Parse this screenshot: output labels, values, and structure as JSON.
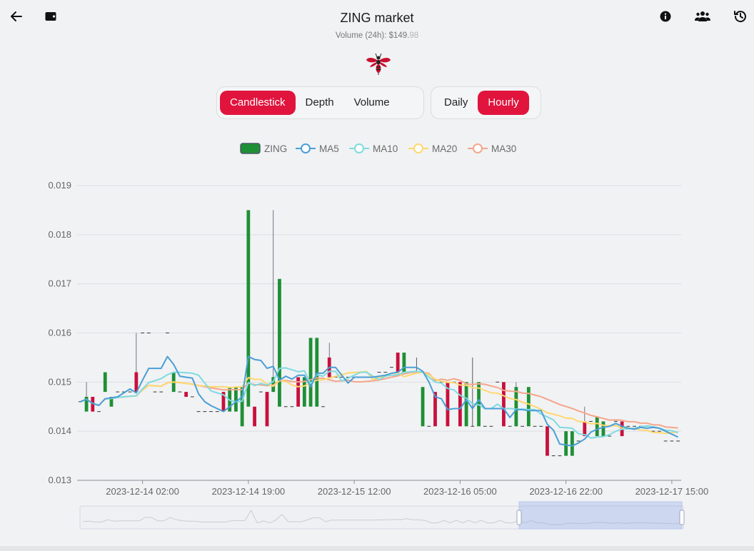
{
  "header": {
    "title": "ZING market",
    "volume_label": "Volume (24h): $149.",
    "volume_dim": "98",
    "back_icon": "arrow-left-icon",
    "wallet_icon": "wallet-icon",
    "info_icon": "info-icon",
    "users_icon": "users-icon",
    "history_icon": "history-icon",
    "logo_icon": "wasp-logo-icon"
  },
  "chart_tabs": [
    {
      "label": "Candlestick",
      "active": true
    },
    {
      "label": "Depth",
      "active": false
    },
    {
      "label": "Volume",
      "active": false
    }
  ],
  "interval_tabs": [
    {
      "label": "Daily",
      "active": false
    },
    {
      "label": "Hourly",
      "active": true
    }
  ],
  "colors": {
    "accent": "#e0143d",
    "up": "#1f8f35",
    "down": "#c8103d",
    "ma5": "#4a9fd6",
    "ma10": "#7fdbe0",
    "ma20": "#ffd86e",
    "ma30": "#f5a68a"
  },
  "chart_data": {
    "type": "candlestick",
    "title": "",
    "legend": [
      {
        "name": "ZING",
        "color": "#1f8f35"
      },
      {
        "name": "MA5",
        "color": "#4a9fd6"
      },
      {
        "name": "MA10",
        "color": "#7fdbe0"
      },
      {
        "name": "MA20",
        "color": "#ffd86e"
      },
      {
        "name": "MA30",
        "color": "#f5a68a"
      }
    ],
    "legend_position": "top-center",
    "grid": true,
    "ylim": [
      0.013,
      0.019
    ],
    "y_ticks": [
      "0.013",
      "0.014",
      "0.015",
      "0.016",
      "0.017",
      "0.018",
      "0.019"
    ],
    "x_ticks": [
      "2023-12-14 02:00",
      "2023-12-14 19:00",
      "2023-12-15 12:00",
      "2023-12-16 05:00",
      "2023-12-16 22:00",
      "2023-12-17 15:00"
    ],
    "x_tick_index": [
      10,
      27,
      44,
      61,
      78,
      95
    ],
    "ohlc": [
      [
        0.0146,
        0.0146,
        0.0146,
        0.0146
      ],
      [
        0.0144,
        0.0147,
        0.0144,
        0.015
      ],
      [
        0.0147,
        0.0144,
        0.0144,
        0.0147
      ],
      [
        0.0144,
        0.0144,
        0.0144,
        0.0144
      ],
      [
        0.0148,
        0.0152,
        0.0148,
        0.0152
      ],
      [
        0.0145,
        0.0147,
        0.0145,
        0.0147
      ],
      [
        0.0148,
        0.0148,
        0.0148,
        0.0148
      ],
      [
        0.0148,
        0.0148,
        0.0148,
        0.0148
      ],
      [
        0.0148,
        0.0148,
        0.0148,
        0.0148
      ],
      [
        0.0152,
        0.0148,
        0.0148,
        0.016
      ],
      [
        0.016,
        0.016,
        0.016,
        0.016
      ],
      [
        0.016,
        0.016,
        0.016,
        0.016
      ],
      [
        0.0148,
        0.0148,
        0.0148,
        0.0148
      ],
      [
        0.0148,
        0.0148,
        0.0148,
        0.0148
      ],
      [
        0.016,
        0.016,
        0.016,
        0.016
      ],
      [
        0.0148,
        0.0152,
        0.0148,
        0.0152
      ],
      [
        0.0148,
        0.0148,
        0.0148,
        0.0148
      ],
      [
        0.0148,
        0.0147,
        0.0147,
        0.0148
      ],
      [
        0.0147,
        0.0147,
        0.0147,
        0.0147
      ],
      [
        0.0144,
        0.0144,
        0.0144,
        0.0144
      ],
      [
        0.0144,
        0.0144,
        0.0144,
        0.0144
      ],
      [
        0.0144,
        0.0144,
        0.0144,
        0.0144
      ],
      [
        0.0144,
        0.0144,
        0.0144,
        0.0144
      ],
      [
        0.0148,
        0.0144,
        0.0144,
        0.0148
      ],
      [
        0.0144,
        0.0149,
        0.0144,
        0.0149
      ],
      [
        0.0144,
        0.0149,
        0.0144,
        0.0149
      ],
      [
        0.0141,
        0.0149,
        0.0141,
        0.0149
      ],
      [
        0.0145,
        0.0185,
        0.0145,
        0.0185
      ],
      [
        0.0145,
        0.0141,
        0.0141,
        0.0145
      ],
      [
        0.0148,
        0.0148,
        0.0148,
        0.0148
      ],
      [
        0.0148,
        0.0141,
        0.0141,
        0.0148
      ],
      [
        0.0148,
        0.0151,
        0.0148,
        0.0185
      ],
      [
        0.0145,
        0.0171,
        0.0145,
        0.0171
      ],
      [
        0.0145,
        0.0145,
        0.0145,
        0.0145
      ],
      [
        0.0145,
        0.0145,
        0.0145,
        0.0145
      ],
      [
        0.0151,
        0.0145,
        0.0145,
        0.0151
      ],
      [
        0.0145,
        0.0151,
        0.0145,
        0.0151
      ],
      [
        0.0145,
        0.0159,
        0.0145,
        0.0159
      ],
      [
        0.0145,
        0.0159,
        0.0145,
        0.0159
      ],
      [
        0.0145,
        0.0145,
        0.0145,
        0.0145
      ],
      [
        0.0155,
        0.0151,
        0.0151,
        0.0158
      ],
      [
        0.0151,
        0.0151,
        0.0151,
        0.0151
      ],
      [
        0.0151,
        0.0151,
        0.0151,
        0.0151
      ],
      [
        0.0151,
        0.0151,
        0.0151,
        0.0151
      ],
      [
        0.0151,
        0.0151,
        0.0151,
        0.0151
      ],
      [
        0.0151,
        0.0151,
        0.0151,
        0.0151
      ],
      [
        0.0151,
        0.0151,
        0.0151,
        0.0151
      ],
      [
        0.0151,
        0.0151,
        0.0151,
        0.0151
      ],
      [
        0.0152,
        0.0152,
        0.0152,
        0.0152
      ],
      [
        0.0152,
        0.0152,
        0.0152,
        0.0152
      ],
      [
        0.0153,
        0.0153,
        0.0153,
        0.0153
      ],
      [
        0.0156,
        0.0152,
        0.0152,
        0.0156
      ],
      [
        0.0152,
        0.0156,
        0.0152,
        0.0156
      ],
      [
        0.0152,
        0.0152,
        0.0152,
        0.0152
      ],
      [
        0.0152,
        0.0152,
        0.0152,
        0.0155
      ],
      [
        0.0141,
        0.0149,
        0.0141,
        0.0149
      ],
      [
        0.0141,
        0.0141,
        0.0141,
        0.0141
      ],
      [
        0.0148,
        0.0141,
        0.0141,
        0.0148
      ],
      [
        0.015,
        0.015,
        0.015,
        0.015
      ],
      [
        0.015,
        0.0141,
        0.0141,
        0.015
      ],
      [
        0.015,
        0.015,
        0.015,
        0.015
      ],
      [
        0.015,
        0.0141,
        0.0141,
        0.015
      ],
      [
        0.0141,
        0.015,
        0.0141,
        0.015
      ],
      [
        0.0141,
        0.0141,
        0.0141,
        0.0155
      ],
      [
        0.0141,
        0.015,
        0.0141,
        0.015
      ],
      [
        0.0141,
        0.0141,
        0.0141,
        0.0141
      ],
      [
        0.0141,
        0.0141,
        0.0141,
        0.0141
      ],
      [
        0.015,
        0.015,
        0.015,
        0.015
      ],
      [
        0.015,
        0.0141,
        0.0141,
        0.015
      ],
      [
        0.0141,
        0.0141,
        0.0141,
        0.0141
      ],
      [
        0.0141,
        0.0149,
        0.0141,
        0.015
      ],
      [
        0.0141,
        0.0141,
        0.0141,
        0.0141
      ],
      [
        0.0141,
        0.0149,
        0.0141,
        0.0149
      ],
      [
        0.0141,
        0.0141,
        0.0141,
        0.0141
      ],
      [
        0.0141,
        0.0141,
        0.0141,
        0.0141
      ],
      [
        0.0141,
        0.0135,
        0.0135,
        0.0141
      ],
      [
        0.0135,
        0.0135,
        0.0135,
        0.0135
      ],
      [
        0.0135,
        0.0135,
        0.0135,
        0.0135
      ],
      [
        0.0135,
        0.014,
        0.0135,
        0.014
      ],
      [
        0.0135,
        0.014,
        0.0135,
        0.014
      ],
      [
        0.0138,
        0.0138,
        0.0138,
        0.0138
      ],
      [
        0.0142,
        0.0139,
        0.0139,
        0.0145
      ],
      [
        0.0142,
        0.0142,
        0.0142,
        0.0142
      ],
      [
        0.0139,
        0.0143,
        0.0139,
        0.0143
      ],
      [
        0.0139,
        0.0142,
        0.0139,
        0.0142
      ],
      [
        0.0139,
        0.0139,
        0.0139,
        0.0139
      ],
      [
        0.0142,
        0.0142,
        0.0142,
        0.0142
      ],
      [
        0.0142,
        0.0139,
        0.0139,
        0.0142
      ],
      [
        0.0141,
        0.0141,
        0.0141,
        0.0141
      ],
      [
        0.0141,
        0.0141,
        0.0141,
        0.0141
      ],
      [
        0.0141,
        0.0141,
        0.0141,
        0.0141
      ],
      [
        0.0141,
        0.0141,
        0.0141,
        0.0141
      ],
      [
        0.014,
        0.014,
        0.014,
        0.014
      ],
      [
        0.014,
        0.014,
        0.014,
        0.014
      ],
      [
        0.0138,
        0.0138,
        0.0138,
        0.0138
      ],
      [
        0.0138,
        0.0138,
        0.0138,
        0.0138
      ],
      [
        0.0138,
        0.0138,
        0.0138,
        0.0138
      ]
    ]
  }
}
